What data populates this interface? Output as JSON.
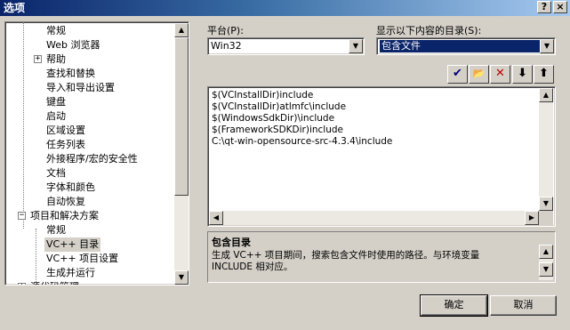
{
  "window": {
    "title": "选项",
    "help_label": "?",
    "close_label": "×"
  },
  "tree": {
    "items": [
      {
        "label": "常规",
        "selected": false
      },
      {
        "label": "Web 浏览器",
        "selected": false
      },
      {
        "label": "帮助",
        "selected": false,
        "expander": "+"
      },
      {
        "label": "查找和替换",
        "selected": false
      },
      {
        "label": "导入和导出设置",
        "selected": false
      },
      {
        "label": "键盘",
        "selected": false
      },
      {
        "label": "启动",
        "selected": false
      },
      {
        "label": "区域设置",
        "selected": false
      },
      {
        "label": "任务列表",
        "selected": false
      },
      {
        "label": "外接程序/宏的安全性",
        "selected": false
      },
      {
        "label": "文档",
        "selected": false
      },
      {
        "label": "字体和颜色",
        "selected": false
      },
      {
        "label": "自动恢复",
        "selected": false
      },
      {
        "label": "项目和解决方案",
        "selected": false,
        "expander": "−"
      },
      {
        "label": "常规",
        "selected": false
      },
      {
        "label": "VC++ 目录",
        "selected": true
      },
      {
        "label": "VC++ 项目设置",
        "selected": false
      },
      {
        "label": "生成并运行",
        "selected": false
      },
      {
        "label": "源代码管理",
        "selected": false,
        "expander": "+"
      }
    ]
  },
  "platform": {
    "label": "平台(P):",
    "value": "Win32"
  },
  "show_dirs": {
    "label": "显示以下内容的目录(S):",
    "value": "包含文件"
  },
  "toolbar": {
    "check_icon": "✔",
    "new_folder_icon": "📂",
    "delete_icon": "✕",
    "down_icon": "⬇",
    "up_icon": "⬆",
    "check_color": "#00007f",
    "delete_color": "#c00000"
  },
  "paths": [
    "$(VCInstallDir)include",
    "$(VCInstallDir)atlmfc\\include",
    "$(WindowsSdkDir)\\include",
    "$(FrameworkSDKDir)include",
    "C:\\qt-win-opensource-src-4.3.4\\include"
  ],
  "description": {
    "title": "包含目录",
    "line1": "生成 VC++ 项目期间，搜索包含文件时使用的路径。与环境变量",
    "line2": "INCLUDE 相对应。"
  },
  "buttons": {
    "ok": "确定",
    "cancel": "取消"
  }
}
